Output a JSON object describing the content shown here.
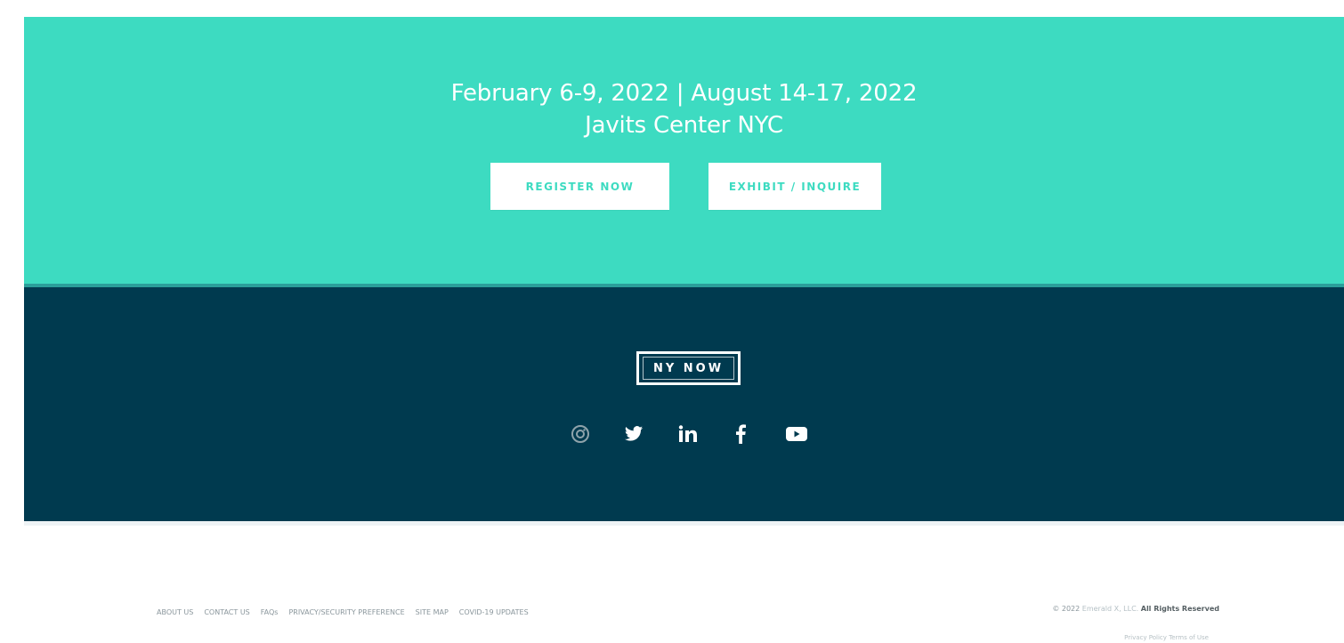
{
  "colors": {
    "teal": "#3ddbc1",
    "teal_dark": "#2a9f9a",
    "navy": "#003a4f",
    "white": "#ffffff",
    "footer_text": "#8a969c"
  },
  "promo": {
    "dates": "February 6-9, 2022  |  August 14-17, 2022",
    "venue": "Javits Center NYC",
    "register_label": "REGISTER NOW",
    "exhibit_label": "EXHIBIT / INQUIRE"
  },
  "footer": {
    "logo_text": "NY NOW",
    "social_icons": [
      "instagram-icon",
      "twitter-icon",
      "linkedin-icon",
      "facebook-icon",
      "youtube-icon"
    ]
  },
  "bottom": {
    "links": [
      "ABOUT US",
      "CONTACT US",
      "FAQs",
      "PRIVACY/SECURITY PREFERENCE",
      "SITE MAP",
      "COVID-19 UPDATES"
    ],
    "copyright_prefix": "© 2022",
    "copyright_link": "Emerald X, LLC.",
    "copyright_suffix": "All Rights Reserved",
    "legal_line": "Privacy Policy  Terms of Use"
  }
}
